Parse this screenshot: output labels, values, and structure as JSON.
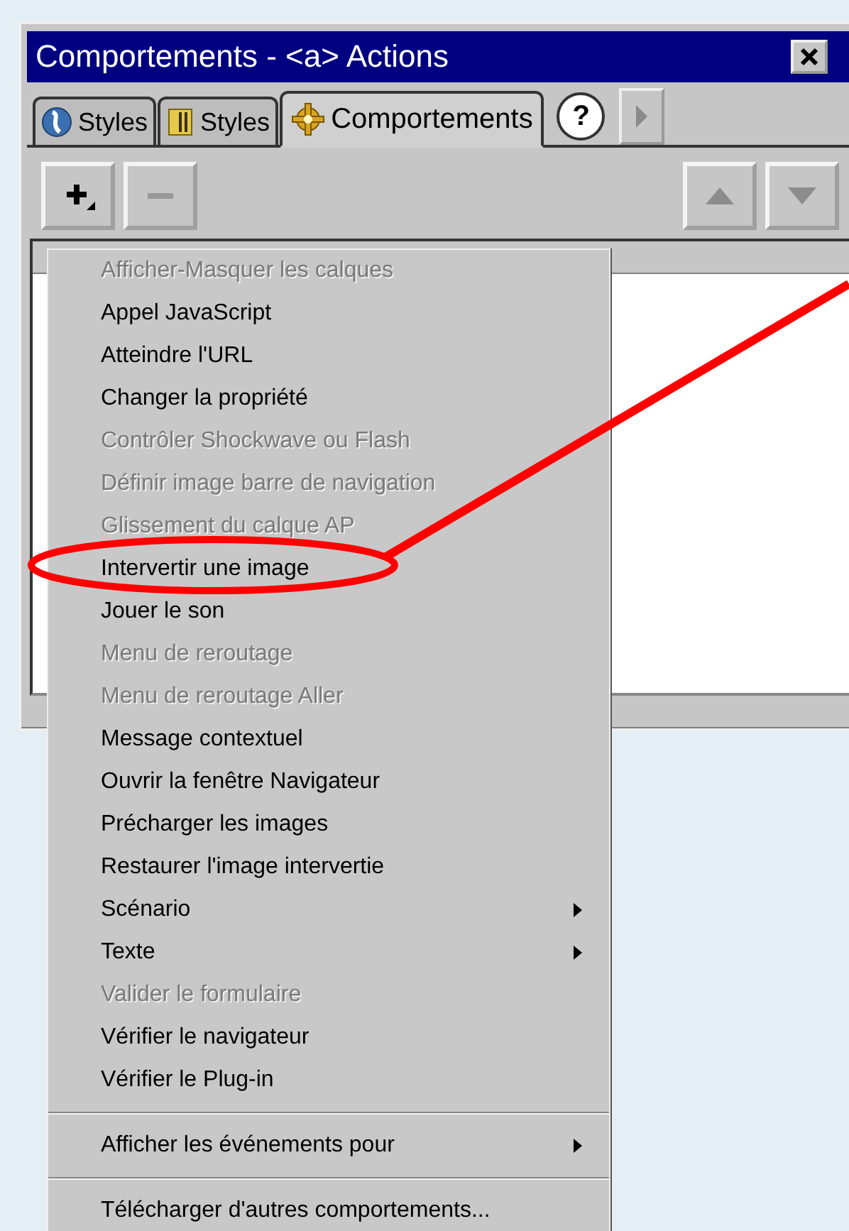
{
  "window": {
    "title": "Comportements - <a> Actions"
  },
  "tabs": [
    {
      "label": "Styles",
      "selected": false
    },
    {
      "label": "Styles",
      "selected": false
    },
    {
      "label": "Comportements",
      "selected": true
    }
  ],
  "help_button": "?",
  "toolbar": [
    {
      "kind": "plus",
      "disabled": false
    },
    {
      "kind": "minus",
      "disabled": true
    },
    {
      "kind": "up",
      "disabled": true
    },
    {
      "kind": "down",
      "disabled": true
    }
  ],
  "menu": {
    "sections": [
      [
        {
          "label": "Afficher-Masquer les calques",
          "disabled": true,
          "submenu": false
        },
        {
          "label": "Appel JavaScript",
          "disabled": false,
          "submenu": false
        },
        {
          "label": "Atteindre l'URL",
          "disabled": false,
          "submenu": false
        },
        {
          "label": "Changer la propriété",
          "disabled": false,
          "submenu": false
        },
        {
          "label": "Contrôler Shockwave ou Flash",
          "disabled": true,
          "submenu": false
        },
        {
          "label": "Définir image barre de navigation",
          "disabled": true,
          "submenu": false
        },
        {
          "label": "Glissement du calque AP",
          "disabled": true,
          "submenu": false
        },
        {
          "label": "Intervertir une image",
          "disabled": false,
          "submenu": false
        },
        {
          "label": "Jouer le son",
          "disabled": false,
          "submenu": false
        },
        {
          "label": "Menu de reroutage",
          "disabled": true,
          "submenu": false
        },
        {
          "label": "Menu de reroutage Aller",
          "disabled": true,
          "submenu": false
        },
        {
          "label": "Message contextuel",
          "disabled": false,
          "submenu": false
        },
        {
          "label": "Ouvrir la fenêtre Navigateur",
          "disabled": false,
          "submenu": false
        },
        {
          "label": "Précharger les images",
          "disabled": false,
          "submenu": false
        },
        {
          "label": "Restaurer l'image intervertie",
          "disabled": false,
          "submenu": false
        },
        {
          "label": "Scénario",
          "disabled": false,
          "submenu": true
        },
        {
          "label": "Texte",
          "disabled": false,
          "submenu": true
        },
        {
          "label": "Valider le formulaire",
          "disabled": true,
          "submenu": false
        },
        {
          "label": "Vérifier le navigateur",
          "disabled": false,
          "submenu": false
        },
        {
          "label": "Vérifier le Plug-in",
          "disabled": false,
          "submenu": false
        }
      ],
      [
        {
          "label": "Afficher les événements pour",
          "disabled": false,
          "submenu": true
        }
      ],
      [
        {
          "label": "Télécharger d'autres comportements...",
          "disabled": false,
          "submenu": false
        }
      ]
    ]
  }
}
